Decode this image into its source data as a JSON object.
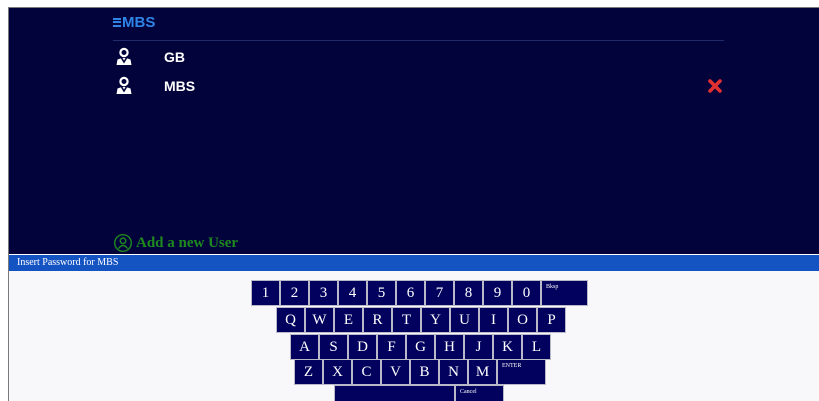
{
  "app": {
    "logo_text": "MBS",
    "users": [
      {
        "name": "GB",
        "icon": "user-icon"
      },
      {
        "name": "MBS",
        "icon": "user-icon",
        "deletable": true
      }
    ],
    "add_user_label": "Add a new User"
  },
  "prompt": {
    "text": "Insert Password for MBS"
  },
  "keyboard": {
    "row1": [
      "1",
      "2",
      "3",
      "4",
      "5",
      "6",
      "7",
      "8",
      "9",
      "0"
    ],
    "backspace": "Bksp",
    "row2": [
      "Q",
      "W",
      "E",
      "R",
      "T",
      "Y",
      "U",
      "I",
      "O",
      "P"
    ],
    "row3": [
      "A",
      "S",
      "D",
      "F",
      "G",
      "H",
      "J",
      "K",
      "L"
    ],
    "row4": [
      "Z",
      "X",
      "C",
      "V",
      "B",
      "N",
      "M"
    ],
    "enter": "ENTER",
    "cancel": "Cancel"
  },
  "colors": {
    "background": "#03033b",
    "accent": "#2f84e8",
    "prompt_bar": "#1453c2",
    "key": "#02025e",
    "add_user": "#1e8a1e",
    "delete": "#e03030"
  }
}
